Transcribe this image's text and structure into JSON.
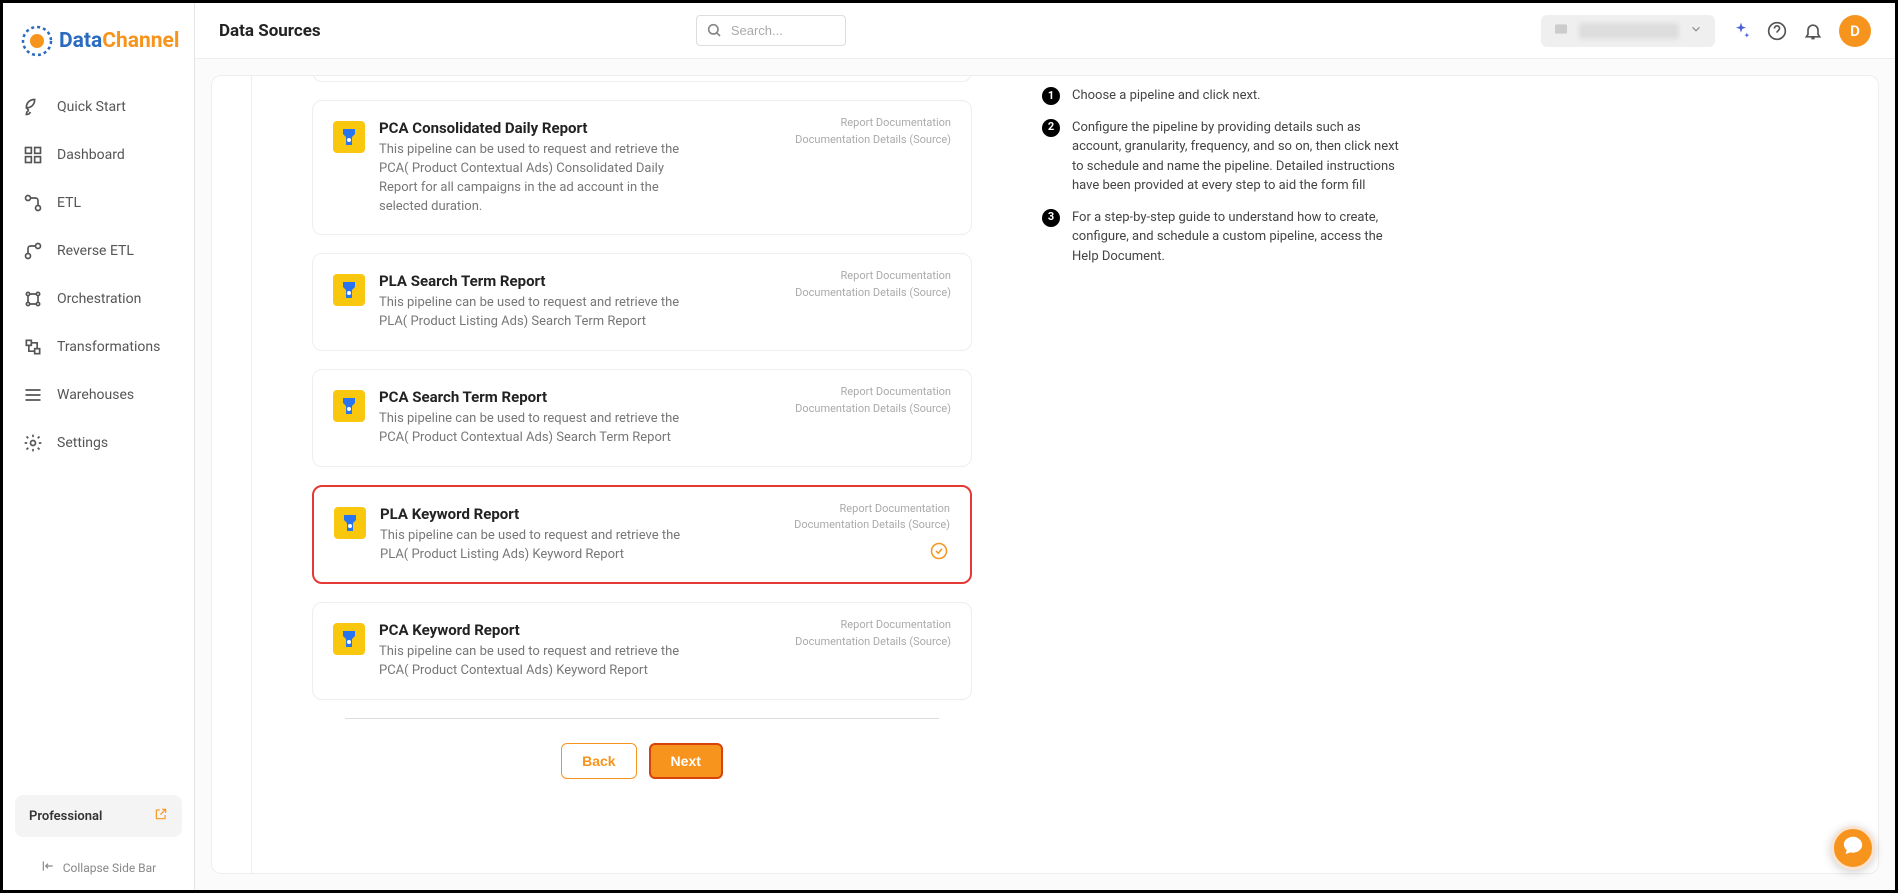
{
  "brand": {
    "part1": "Data",
    "part2": "Channel"
  },
  "page_title": "Data Sources",
  "search_placeholder": "Search...",
  "avatar_letter": "D",
  "plan_label": "Professional",
  "collapse_label": "Collapse Side Bar",
  "nav": [
    {
      "label": "Quick Start",
      "icon": "rocket"
    },
    {
      "label": "Dashboard",
      "icon": "grid"
    },
    {
      "label": "ETL",
      "icon": "flow"
    },
    {
      "label": "Reverse ETL",
      "icon": "reverse"
    },
    {
      "label": "Orchestration",
      "icon": "orch"
    },
    {
      "label": "Transformations",
      "icon": "transform"
    },
    {
      "label": "Warehouses",
      "icon": "warehouse"
    },
    {
      "label": "Settings",
      "icon": "gear"
    }
  ],
  "reports": [
    {
      "title": "PCA Consolidated Daily Report",
      "desc": "This pipeline can be used to request and retrieve the PCA( Product Contextual Ads) Consolidated Daily Report for all campaigns in the ad account in the selected duration.",
      "link1": "Report Documentation",
      "link2": "Documentation Details (Source)",
      "selected": false
    },
    {
      "title": "PLA Search Term Report",
      "desc": "This pipeline can be used to request and retrieve the PLA( Product Listing Ads) Search Term Report",
      "link1": "Report Documentation",
      "link2": "Documentation Details (Source)",
      "selected": false
    },
    {
      "title": "PCA Search Term Report",
      "desc": "This pipeline can be used to request and retrieve the PCA( Product Contextual Ads) Search Term Report",
      "link1": "Report Documentation",
      "link2": "Documentation Details (Source)",
      "selected": false
    },
    {
      "title": "PLA Keyword Report",
      "desc": "This pipeline can be used to request and retrieve the PLA( Product Listing Ads) Keyword Report",
      "link1": "Report Documentation",
      "link2": "Documentation Details (Source)",
      "selected": true
    },
    {
      "title": "PCA Keyword Report",
      "desc": "This pipeline can be used to request and retrieve the PCA( Product Contextual Ads) Keyword Report",
      "link1": "Report Documentation",
      "link2": "Documentation Details (Source)",
      "selected": false
    }
  ],
  "buttons": {
    "back": "Back",
    "next": "Next"
  },
  "steps": [
    "Choose a pipeline and click next.",
    "Configure the pipeline by providing details such as account, granularity, frequency, and so on, then click next to schedule and name the pipeline. Detailed instructions have been provided at every step to aid the form fill",
    "For a step-by-step guide to understand how to create, configure, and schedule a custom pipeline, access the Help Document."
  ]
}
